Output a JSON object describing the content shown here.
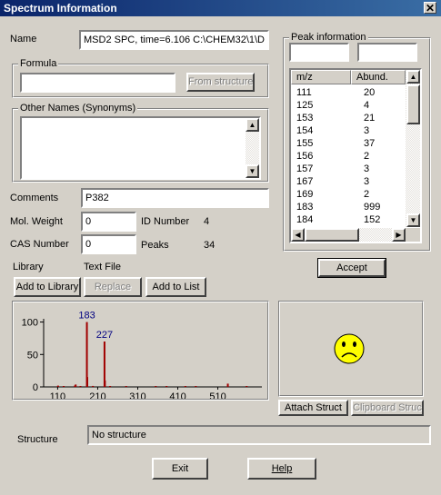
{
  "window": {
    "title": "Spectrum Information",
    "close_glyph": "✕"
  },
  "name": {
    "label": "Name",
    "value": "MSD2 SPC, time=6.106 C:\\CHEM32\\1\\D"
  },
  "formula": {
    "legend": "Formula",
    "value": "",
    "from_structure": "From structure"
  },
  "other_names": {
    "legend": "Other Names (Synonyms)",
    "value": ""
  },
  "comments": {
    "label": "Comments",
    "value": "P382"
  },
  "mol_weight": {
    "label": "Mol. Weight",
    "value": "0"
  },
  "cas_number": {
    "label": "CAS Number",
    "value": "0"
  },
  "id_number": {
    "label": "ID Number",
    "value": "4"
  },
  "peaks": {
    "label": "Peaks",
    "value": "34"
  },
  "library": {
    "label": "Library",
    "value": "Text File"
  },
  "buttons": {
    "add_to_library": "Add to Library",
    "replace": "Replace",
    "add_to_list": "Add to List",
    "accept": "Accept",
    "attach_struct": "Attach Struct",
    "clipboard_struct": "Clipboard Struct",
    "exit": "Exit",
    "help": "Help"
  },
  "peak_info": {
    "legend": "Peak information",
    "input1": "",
    "input2": "",
    "col_mz": "m/z",
    "col_abund": "Abund.",
    "rows": [
      {
        "mz": "111",
        "abund": "20"
      },
      {
        "mz": "125",
        "abund": "4"
      },
      {
        "mz": "153",
        "abund": "21"
      },
      {
        "mz": "154",
        "abund": "3"
      },
      {
        "mz": "155",
        "abund": "37"
      },
      {
        "mz": "156",
        "abund": "2"
      },
      {
        "mz": "157",
        "abund": "3"
      },
      {
        "mz": "167",
        "abund": "3"
      },
      {
        "mz": "169",
        "abund": "2"
      },
      {
        "mz": "183",
        "abund": "999"
      },
      {
        "mz": "184",
        "abund": "152"
      }
    ]
  },
  "structure": {
    "label": "Structure",
    "value": "No structure",
    "placeholder_icon": "sad-face-icon",
    "face_color": "#ffff00"
  },
  "chart_data": {
    "type": "bar",
    "x_ticks": [
      "110",
      "210",
      "310",
      "410",
      "510"
    ],
    "y_ticks": [
      "0",
      "50",
      "100"
    ],
    "ylim": [
      0,
      105
    ],
    "xlim": [
      75,
      620
    ],
    "bar_color": "#a00000",
    "label_color": "#000080",
    "annotations": [
      {
        "x": 183,
        "label": "183"
      },
      {
        "x": 227,
        "label": "227"
      }
    ],
    "peaks": [
      {
        "x": 111,
        "y": 2
      },
      {
        "x": 125,
        "y": 0.4
      },
      {
        "x": 153,
        "y": 2.1
      },
      {
        "x": 155,
        "y": 3.7
      },
      {
        "x": 167,
        "y": 0.3
      },
      {
        "x": 183,
        "y": 100
      },
      {
        "x": 184,
        "y": 15.2
      },
      {
        "x": 198,
        "y": 1.5
      },
      {
        "x": 227,
        "y": 70
      },
      {
        "x": 228,
        "y": 10
      },
      {
        "x": 241,
        "y": 1
      },
      {
        "x": 281,
        "y": 0.5
      },
      {
        "x": 355,
        "y": 0.5
      },
      {
        "x": 382,
        "y": 1
      },
      {
        "x": 429,
        "y": 0.5
      },
      {
        "x": 455,
        "y": 0.5
      },
      {
        "x": 535,
        "y": 5
      },
      {
        "x": 582,
        "y": 0.5
      }
    ]
  }
}
